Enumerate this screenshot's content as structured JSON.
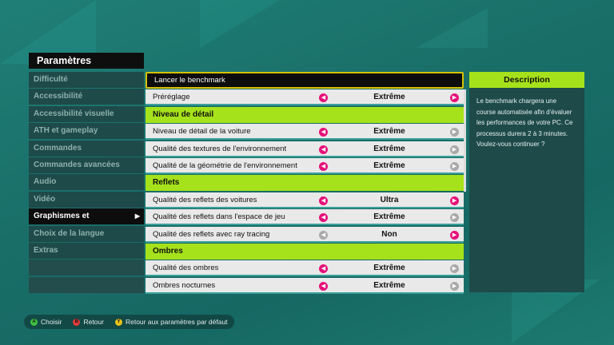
{
  "title": "Paramètres",
  "sidebar": [
    {
      "label": "Difficulté",
      "active": false
    },
    {
      "label": "Accessibilité",
      "active": false
    },
    {
      "label": "Accessibilité visuelle",
      "active": false
    },
    {
      "label": "ATH et gameplay",
      "active": false
    },
    {
      "label": "Commandes",
      "active": false
    },
    {
      "label": "Commandes avancées",
      "active": false
    },
    {
      "label": "Audio",
      "active": false
    },
    {
      "label": "Vidéo",
      "active": false
    },
    {
      "label": "Graphismes et performances",
      "active": true
    },
    {
      "label": "Choix de la langue",
      "active": false
    },
    {
      "label": "Extras",
      "active": false
    }
  ],
  "rows": [
    {
      "type": "bench",
      "label": "Lancer le benchmark"
    },
    {
      "type": "option",
      "label": "Préréglage",
      "value": "Extrême",
      "left": "on",
      "right": "on"
    },
    {
      "type": "header",
      "label": "Niveau de détail"
    },
    {
      "type": "option",
      "label": "Niveau de détail de la voiture",
      "value": "Extrême",
      "left": "on",
      "right": "off"
    },
    {
      "type": "option",
      "label": "Qualité des textures de l'environnement",
      "value": "Extrême",
      "left": "on",
      "right": "off"
    },
    {
      "type": "option",
      "label": "Qualité de la géométrie de l'environnement",
      "value": "Extrême",
      "left": "on",
      "right": "off"
    },
    {
      "type": "header",
      "label": "Reflets"
    },
    {
      "type": "option",
      "label": "Qualité des reflets des voitures",
      "value": "Ultra",
      "left": "on",
      "right": "on"
    },
    {
      "type": "option",
      "label": "Qualité des reflets dans l'espace de jeu",
      "value": "Extrême",
      "left": "on",
      "right": "off"
    },
    {
      "type": "option",
      "label": "Qualité des reflets avec ray tracing",
      "value": "Non",
      "left": "off",
      "right": "on"
    },
    {
      "type": "header",
      "label": "Ombres"
    },
    {
      "type": "option",
      "label": "Qualité des ombres",
      "value": "Extrême",
      "left": "on",
      "right": "off"
    },
    {
      "type": "option",
      "label": "Ombres nocturnes",
      "value": "Extrême",
      "left": "on",
      "right": "off"
    }
  ],
  "description": {
    "title": "Description",
    "text": "Le benchmark chargera une course automatisée afin d'évaluer les performances de votre PC. Ce processus durera 2 à 3 minutes. Voulez-vous continuer ?"
  },
  "footer": [
    {
      "glyph": "A",
      "label": "Choisir",
      "color": "#3fbf3f"
    },
    {
      "glyph": "B",
      "label": "Retour",
      "color": "#e33b3b"
    },
    {
      "glyph": "Y",
      "label": "Retour aux paramètres par défaut",
      "color": "#e6c21a"
    }
  ],
  "colors": {
    "accent": "#a6e21b",
    "arrow": "#e5107a",
    "focus_border": "#d6c200"
  }
}
